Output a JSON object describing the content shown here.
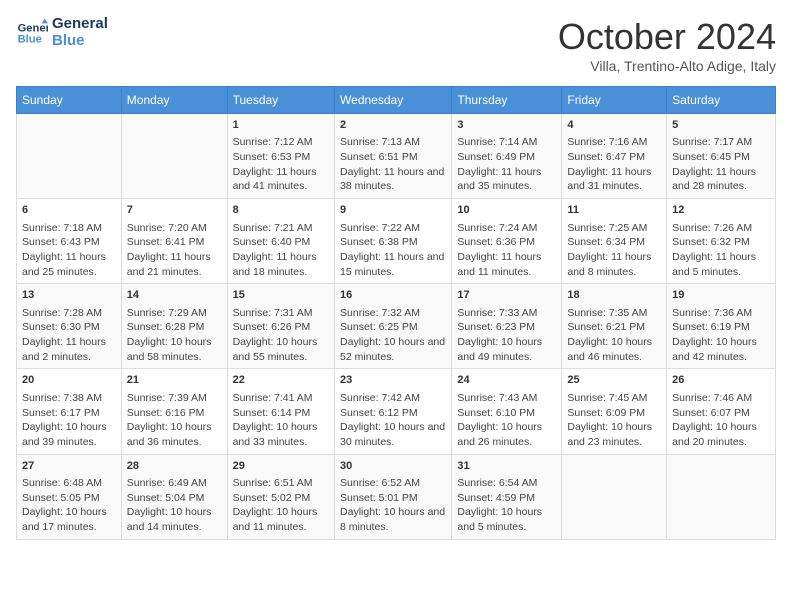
{
  "header": {
    "logo_line1": "General",
    "logo_line2": "Blue",
    "month": "October 2024",
    "location": "Villa, Trentino-Alto Adige, Italy"
  },
  "days_of_week": [
    "Sunday",
    "Monday",
    "Tuesday",
    "Wednesday",
    "Thursday",
    "Friday",
    "Saturday"
  ],
  "weeks": [
    [
      {
        "day": "",
        "content": ""
      },
      {
        "day": "",
        "content": ""
      },
      {
        "day": "1",
        "content": "Sunrise: 7:12 AM\nSunset: 6:53 PM\nDaylight: 11 hours and 41 minutes."
      },
      {
        "day": "2",
        "content": "Sunrise: 7:13 AM\nSunset: 6:51 PM\nDaylight: 11 hours and 38 minutes."
      },
      {
        "day": "3",
        "content": "Sunrise: 7:14 AM\nSunset: 6:49 PM\nDaylight: 11 hours and 35 minutes."
      },
      {
        "day": "4",
        "content": "Sunrise: 7:16 AM\nSunset: 6:47 PM\nDaylight: 11 hours and 31 minutes."
      },
      {
        "day": "5",
        "content": "Sunrise: 7:17 AM\nSunset: 6:45 PM\nDaylight: 11 hours and 28 minutes."
      }
    ],
    [
      {
        "day": "6",
        "content": "Sunrise: 7:18 AM\nSunset: 6:43 PM\nDaylight: 11 hours and 25 minutes."
      },
      {
        "day": "7",
        "content": "Sunrise: 7:20 AM\nSunset: 6:41 PM\nDaylight: 11 hours and 21 minutes."
      },
      {
        "day": "8",
        "content": "Sunrise: 7:21 AM\nSunset: 6:40 PM\nDaylight: 11 hours and 18 minutes."
      },
      {
        "day": "9",
        "content": "Sunrise: 7:22 AM\nSunset: 6:38 PM\nDaylight: 11 hours and 15 minutes."
      },
      {
        "day": "10",
        "content": "Sunrise: 7:24 AM\nSunset: 6:36 PM\nDaylight: 11 hours and 11 minutes."
      },
      {
        "day": "11",
        "content": "Sunrise: 7:25 AM\nSunset: 6:34 PM\nDaylight: 11 hours and 8 minutes."
      },
      {
        "day": "12",
        "content": "Sunrise: 7:26 AM\nSunset: 6:32 PM\nDaylight: 11 hours and 5 minutes."
      }
    ],
    [
      {
        "day": "13",
        "content": "Sunrise: 7:28 AM\nSunset: 6:30 PM\nDaylight: 11 hours and 2 minutes."
      },
      {
        "day": "14",
        "content": "Sunrise: 7:29 AM\nSunset: 6:28 PM\nDaylight: 10 hours and 58 minutes."
      },
      {
        "day": "15",
        "content": "Sunrise: 7:31 AM\nSunset: 6:26 PM\nDaylight: 10 hours and 55 minutes."
      },
      {
        "day": "16",
        "content": "Sunrise: 7:32 AM\nSunset: 6:25 PM\nDaylight: 10 hours and 52 minutes."
      },
      {
        "day": "17",
        "content": "Sunrise: 7:33 AM\nSunset: 6:23 PM\nDaylight: 10 hours and 49 minutes."
      },
      {
        "day": "18",
        "content": "Sunrise: 7:35 AM\nSunset: 6:21 PM\nDaylight: 10 hours and 46 minutes."
      },
      {
        "day": "19",
        "content": "Sunrise: 7:36 AM\nSunset: 6:19 PM\nDaylight: 10 hours and 42 minutes."
      }
    ],
    [
      {
        "day": "20",
        "content": "Sunrise: 7:38 AM\nSunset: 6:17 PM\nDaylight: 10 hours and 39 minutes."
      },
      {
        "day": "21",
        "content": "Sunrise: 7:39 AM\nSunset: 6:16 PM\nDaylight: 10 hours and 36 minutes."
      },
      {
        "day": "22",
        "content": "Sunrise: 7:41 AM\nSunset: 6:14 PM\nDaylight: 10 hours and 33 minutes."
      },
      {
        "day": "23",
        "content": "Sunrise: 7:42 AM\nSunset: 6:12 PM\nDaylight: 10 hours and 30 minutes."
      },
      {
        "day": "24",
        "content": "Sunrise: 7:43 AM\nSunset: 6:10 PM\nDaylight: 10 hours and 26 minutes."
      },
      {
        "day": "25",
        "content": "Sunrise: 7:45 AM\nSunset: 6:09 PM\nDaylight: 10 hours and 23 minutes."
      },
      {
        "day": "26",
        "content": "Sunrise: 7:46 AM\nSunset: 6:07 PM\nDaylight: 10 hours and 20 minutes."
      }
    ],
    [
      {
        "day": "27",
        "content": "Sunrise: 6:48 AM\nSunset: 5:05 PM\nDaylight: 10 hours and 17 minutes."
      },
      {
        "day": "28",
        "content": "Sunrise: 6:49 AM\nSunset: 5:04 PM\nDaylight: 10 hours and 14 minutes."
      },
      {
        "day": "29",
        "content": "Sunrise: 6:51 AM\nSunset: 5:02 PM\nDaylight: 10 hours and 11 minutes."
      },
      {
        "day": "30",
        "content": "Sunrise: 6:52 AM\nSunset: 5:01 PM\nDaylight: 10 hours and 8 minutes."
      },
      {
        "day": "31",
        "content": "Sunrise: 6:54 AM\nSunset: 4:59 PM\nDaylight: 10 hours and 5 minutes."
      },
      {
        "day": "",
        "content": ""
      },
      {
        "day": "",
        "content": ""
      }
    ]
  ]
}
